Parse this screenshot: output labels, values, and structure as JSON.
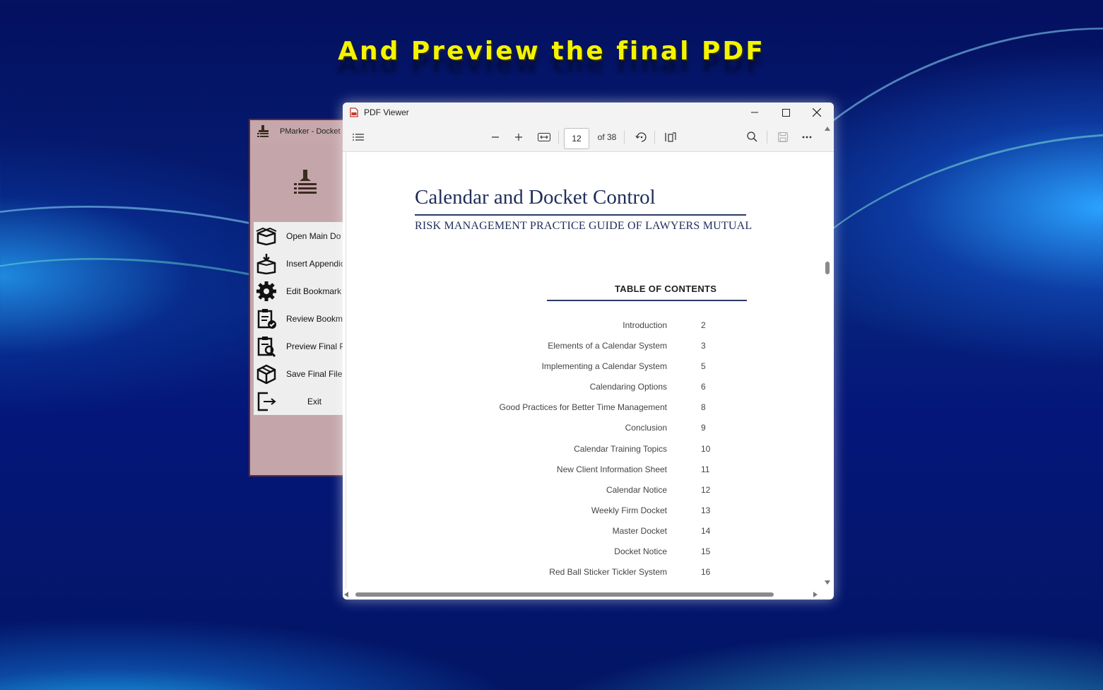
{
  "promo": {
    "headline": "And Preview the final PDF"
  },
  "pmarker": {
    "title": "PMarker - Docket",
    "menu": [
      {
        "label": "Open Main Do",
        "icon": "open-box-icon"
      },
      {
        "label": "Insert Appendic",
        "icon": "insert-box-icon"
      },
      {
        "label": "Edit Bookmark",
        "icon": "gear-icon"
      },
      {
        "label": "Review Bookma",
        "icon": "clipboard-check-icon"
      },
      {
        "label": "Preview Final Pl",
        "icon": "clipboard-search-icon"
      },
      {
        "label": "Save Final File",
        "icon": "package-icon"
      },
      {
        "label": "Exit",
        "icon": "exit-icon"
      }
    ]
  },
  "viewer": {
    "title": "PDF Viewer",
    "page_number": "12",
    "page_total": "of 38",
    "document": {
      "title": "Calendar and Docket Control",
      "subtitle": "RISK MANAGEMENT PRACTICE GUIDE OF LAWYERS MUTUAL",
      "toc_heading": "TABLE OF CONTENTS",
      "toc": [
        {
          "entry": "Introduction",
          "page": "2"
        },
        {
          "entry": "Elements of a Calendar System",
          "page": "3"
        },
        {
          "entry": "Implementing a Calendar System",
          "page": "5"
        },
        {
          "entry": "Calendaring Options",
          "page": "6"
        },
        {
          "entry": "Good Practices for Better Time Management",
          "page": "8"
        },
        {
          "entry": "Conclusion",
          "page": "9"
        },
        {
          "entry": "Calendar Training Topics",
          "page": "10"
        },
        {
          "entry": "New Client Information Sheet",
          "page": "11"
        },
        {
          "entry": "Calendar Notice",
          "page": "12"
        },
        {
          "entry": "Weekly Firm Docket",
          "page": "13"
        },
        {
          "entry": "Master Docket",
          "page": "14"
        },
        {
          "entry": "Docket Notice",
          "page": "15"
        },
        {
          "entry": "Red Ball Sticker Tickler System",
          "page": "16"
        }
      ]
    }
  }
}
